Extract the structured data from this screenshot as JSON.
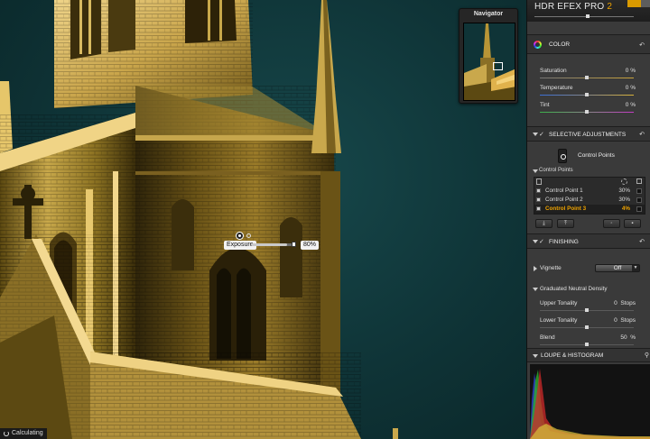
{
  "canvas": {
    "control_point": {
      "label": "Exposure",
      "value": "80%",
      "level": 0.8
    },
    "status": "Calculating"
  },
  "navigator": {
    "title": "Navigator"
  },
  "panel": {
    "product_name": "HDR EFEX PRO",
    "product_version": "2",
    "color": {
      "title": "COLOR",
      "rows": [
        {
          "label": "Saturation",
          "value": "0 %"
        },
        {
          "label": "Temperature",
          "value": "0 %"
        },
        {
          "label": "Tint",
          "value": "0 %"
        }
      ]
    },
    "selective": {
      "title": "SELECTIVE ADJUSTMENTS",
      "button_label": "Control Points",
      "list_title": "Control Points",
      "points": [
        {
          "name": "Control Point 1",
          "percent": "30%"
        },
        {
          "name": "Control Point 2",
          "percent": "30%"
        },
        {
          "name": "Control Point 3",
          "percent": "4%"
        }
      ]
    },
    "finishing": {
      "title": "FINISHING",
      "vignette_label": "Vignette",
      "vignette_value": "Off",
      "gnd_title": "Graduated Neutral Density",
      "rows": [
        {
          "label": "Upper Tonality",
          "value": "0",
          "unit": "Stops"
        },
        {
          "label": "Lower Tonality",
          "value": "0",
          "unit": "Stops"
        },
        {
          "label": "Blend",
          "value": "50",
          "unit": "%"
        }
      ]
    },
    "loupe": {
      "title": "LOUPE & HISTOGRAM"
    },
    "accent_color": "#f0a400"
  }
}
